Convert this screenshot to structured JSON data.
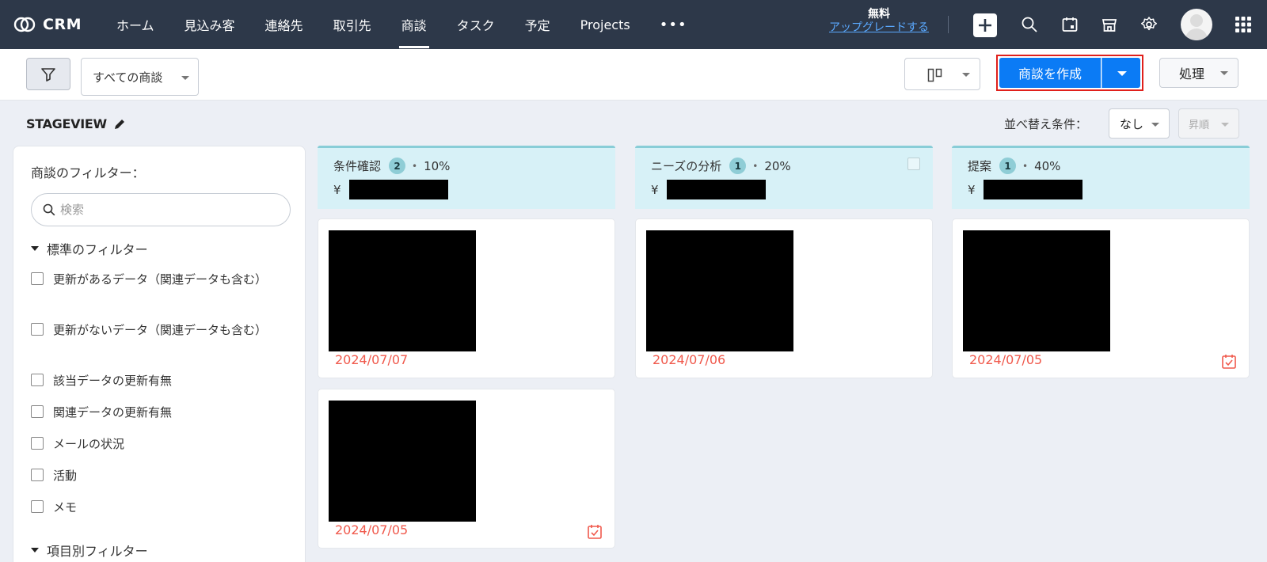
{
  "nav": {
    "brand": "CRM",
    "items": [
      {
        "label": "ホーム",
        "active": false
      },
      {
        "label": "見込み客",
        "active": false
      },
      {
        "label": "連絡先",
        "active": false
      },
      {
        "label": "取引先",
        "active": false
      },
      {
        "label": "商談",
        "active": true
      },
      {
        "label": "タスク",
        "active": false
      },
      {
        "label": "予定",
        "active": false
      },
      {
        "label": "Projects",
        "active": false
      }
    ],
    "more": "•••",
    "plan": "無料",
    "upgrade": "アップグレードする"
  },
  "toolbar": {
    "view": "すべての商談",
    "create": "商談を作成",
    "action": "処理"
  },
  "stageview": {
    "title": "STAGEVIEW",
    "sort_label": "並べ替え条件：",
    "sort_value": "なし",
    "order_value": "昇順"
  },
  "filters": {
    "title": "商談のフィルター：",
    "search_placeholder": "検索",
    "standard_group": "標準のフィルター",
    "items": [
      "更新があるデータ（関連データも含む）",
      "更新がないデータ（関連データも含む）",
      "該当データの更新有無",
      "関連データの更新有無",
      "メールの状況",
      "活動",
      "メモ"
    ],
    "field_group": "項目別フィルター"
  },
  "columns": [
    {
      "name": "条件確認",
      "count": "2",
      "percent": "10%",
      "currency": "¥",
      "cards": [
        {
          "date": "2024/07/07",
          "task": false
        },
        {
          "date": "2024/07/05",
          "task": true
        }
      ]
    },
    {
      "name": "ニーズの分析",
      "count": "1",
      "percent": "20%",
      "currency": "¥",
      "cards": [
        {
          "date": "2024/07/06",
          "task": false
        }
      ]
    },
    {
      "name": "提案",
      "count": "1",
      "percent": "40%",
      "currency": "¥",
      "cards": [
        {
          "date": "2024/07/05",
          "task": true
        }
      ]
    }
  ],
  "colors": {
    "nav_bg": "#2d3849",
    "accent": "#0b7bf5",
    "stage_header": "#d7f1f7",
    "date": "#f0594c",
    "highlight": "#e0201c"
  }
}
